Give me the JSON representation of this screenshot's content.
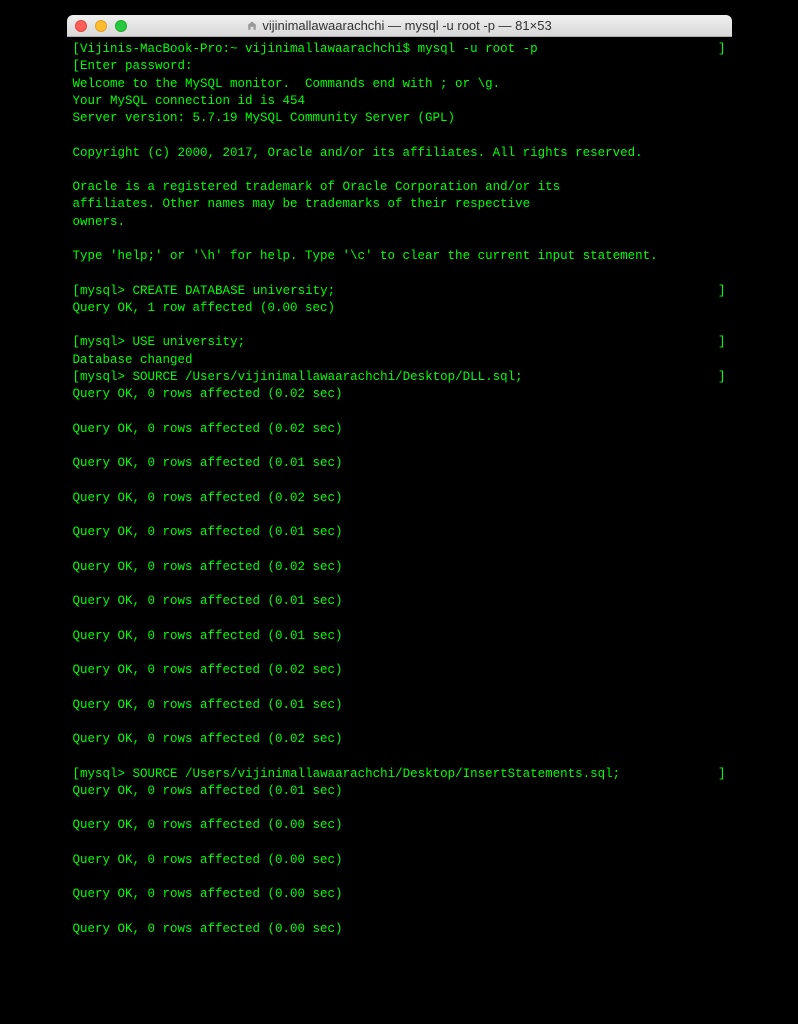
{
  "window": {
    "title": "vijinimallawaarachchi — mysql -u root -p — 81×53"
  },
  "prompt": {
    "host": "Vijinis-MacBook-Pro:~ vijinimallawaarachchi$",
    "command": "mysql -u root -p"
  },
  "lines": {
    "enter_password": "Enter password:",
    "welcome": "Welcome to the MySQL monitor.  Commands end with ; or \\g.",
    "conn_id": "Your MySQL connection id is 454",
    "version": "Server version: 5.7.19 MySQL Community Server (GPL)",
    "copyright": "Copyright (c) 2000, 2017, Oracle and/or its affiliates. All rights reserved.",
    "trademark1": "Oracle is a registered trademark of Oracle Corporation and/or its",
    "trademark2": "affiliates. Other names may be trademarks of their respective",
    "trademark3": "owners.",
    "help": "Type 'help;' or '\\h' for help. Type '\\c' to clear the current input statement."
  },
  "mysql_prompt": "mysql>",
  "commands": {
    "create_db": "CREATE DATABASE university;",
    "create_db_result": "Query OK, 1 row affected (0.00 sec)",
    "use_db": "USE university;",
    "use_db_result": "Database changed",
    "source1": "SOURCE /Users/vijinimallawaarachchi/Desktop/DLL.sql;",
    "source2": "SOURCE /Users/vijinimallawaarachchi/Desktop/InsertStatements.sql;"
  },
  "source1_results": [
    "Query OK, 0 rows affected (0.02 sec)",
    "Query OK, 0 rows affected (0.02 sec)",
    "Query OK, 0 rows affected (0.01 sec)",
    "Query OK, 0 rows affected (0.02 sec)",
    "Query OK, 0 rows affected (0.01 sec)",
    "Query OK, 0 rows affected (0.02 sec)",
    "Query OK, 0 rows affected (0.01 sec)",
    "Query OK, 0 rows affected (0.01 sec)",
    "Query OK, 0 rows affected (0.02 sec)",
    "Query OK, 0 rows affected (0.01 sec)",
    "Query OK, 0 rows affected (0.02 sec)"
  ],
  "source2_results": [
    "Query OK, 0 rows affected (0.01 sec)",
    "Query OK, 0 rows affected (0.00 sec)",
    "Query OK, 0 rows affected (0.00 sec)",
    "Query OK, 0 rows affected (0.00 sec)",
    "Query OK, 0 rows affected (0.00 sec)"
  ],
  "brackets": {
    "l": "[",
    "r": "]"
  }
}
